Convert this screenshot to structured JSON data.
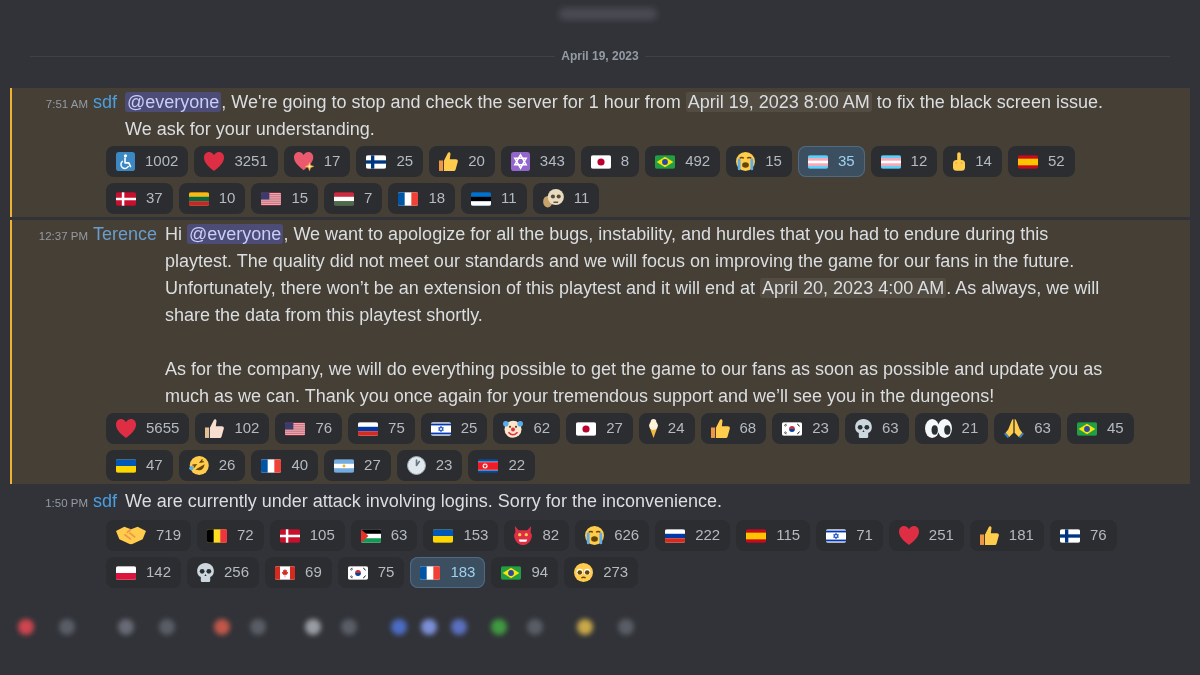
{
  "date_divider": {
    "label": "April 19, 2023"
  },
  "messages": [
    {
      "time": "7:51 AM",
      "author": {
        "name": "sdf",
        "color": "#4a9fe3"
      },
      "mentioned": true,
      "paragraphs": [
        {
          "lines": [
            [
              {
                "kind": "mention",
                "text": "@everyone"
              },
              {
                "kind": "text",
                "text": ", We're going to stop and check the server for 1 hour from "
              },
              {
                "kind": "timestamp",
                "text": "April 19, 2023 8:00 AM"
              },
              {
                "kind": "text",
                "text": " to fix the black screen issue."
              }
            ],
            [
              {
                "kind": "text",
                "text": "We ask for your understanding."
              }
            ]
          ]
        }
      ],
      "reactions": [
        {
          "kind": "wheelchair",
          "count": "1002",
          "selected": false
        },
        {
          "kind": "heart",
          "count": "3251",
          "selected": false
        },
        {
          "kind": "sparkleheart",
          "count": "17",
          "selected": false
        },
        {
          "kind": "finland",
          "count": "25",
          "selected": false
        },
        {
          "kind": "thumbsup",
          "count": "20",
          "selected": false
        },
        {
          "kind": "starofdavid",
          "count": "343",
          "selected": false
        },
        {
          "kind": "japan",
          "count": "8",
          "selected": false
        },
        {
          "kind": "brazil",
          "count": "492",
          "selected": false
        },
        {
          "kind": "crying",
          "count": "15",
          "selected": false
        },
        {
          "kind": "transgender",
          "count": "35",
          "selected": true
        },
        {
          "kind": "transgender",
          "count": "12",
          "selected": false
        },
        {
          "kind": "middlefinger",
          "count": "14",
          "selected": false
        },
        {
          "kind": "spain",
          "count": "52",
          "selected": false
        },
        {
          "kind": "denmark",
          "count": "37",
          "selected": false
        },
        {
          "kind": "lithuania",
          "count": "10",
          "selected": false
        },
        {
          "kind": "usa",
          "count": "15",
          "selected": false
        },
        {
          "kind": "hungary",
          "count": "7",
          "selected": false
        },
        {
          "kind": "france",
          "count": "18",
          "selected": false
        },
        {
          "kind": "estonia",
          "count": "11",
          "selected": false
        },
        {
          "kind": "custom",
          "count": "11",
          "selected": false
        }
      ]
    },
    {
      "time": "12:37 PM",
      "author": {
        "name": "Terence",
        "color": "#6b9dcc"
      },
      "mentioned": true,
      "paragraphs": [
        {
          "lines": [
            [
              {
                "kind": "text",
                "text": "Hi "
              },
              {
                "kind": "mention",
                "text": "@everyone"
              },
              {
                "kind": "text",
                "text": ", We want to apologize for all the bugs, instability, and hurdles that you had to endure during this playtest. The quality did not meet our standards and we will focus on improving the game for our fans in the future. Unfortunately, there won’t be an extension of this playtest and it will end at "
              },
              {
                "kind": "timestamp",
                "text": "April 20, 2023 4:00 AM"
              },
              {
                "kind": "text",
                "text": ". As always, we will share the data from this playtest shortly."
              }
            ]
          ]
        },
        {
          "lines": [
            [
              {
                "kind": "text",
                "text": "As for the company, we will do everything possible to get the game to our fans as soon as possible and update you as much as we can. Thank you once again for your tremendous support and we’ll see you in the dungeons!"
              }
            ]
          ]
        }
      ],
      "reactions": [
        {
          "kind": "heart",
          "count": "5655",
          "selected": false
        },
        {
          "kind": "thumbsuplight",
          "count": "102",
          "selected": false
        },
        {
          "kind": "usa",
          "count": "76",
          "selected": false
        },
        {
          "kind": "russia",
          "count": "75",
          "selected": false
        },
        {
          "kind": "israel",
          "count": "25",
          "selected": false
        },
        {
          "kind": "clown",
          "count": "62",
          "selected": false
        },
        {
          "kind": "japan",
          "count": "27",
          "selected": false
        },
        {
          "kind": "icecream",
          "count": "24",
          "selected": false
        },
        {
          "kind": "thumbsup",
          "count": "68",
          "selected": false
        },
        {
          "kind": "southkorea",
          "count": "23",
          "selected": false
        },
        {
          "kind": "skull",
          "count": "63",
          "selected": false
        },
        {
          "kind": "eyes",
          "count": "21",
          "selected": false
        },
        {
          "kind": "pray",
          "count": "63",
          "selected": false
        },
        {
          "kind": "brazil",
          "count": "45",
          "selected": false
        },
        {
          "kind": "ukraine",
          "count": "47",
          "selected": false
        },
        {
          "kind": "rofl",
          "count": "26",
          "selected": false
        },
        {
          "kind": "france",
          "count": "40",
          "selected": false
        },
        {
          "kind": "argentina",
          "count": "27",
          "selected": false
        },
        {
          "kind": "clock",
          "count": "23",
          "selected": false
        },
        {
          "kind": "northkorea",
          "count": "22",
          "selected": false
        }
      ]
    },
    {
      "time": "1:50 PM",
      "author": {
        "name": "sdf",
        "color": "#4a9fe3"
      },
      "mentioned": false,
      "paragraphs": [
        {
          "lines": [
            [
              {
                "kind": "text",
                "text": "We are currently under attack involving logins. Sorry for the inconvenience."
              }
            ]
          ]
        }
      ],
      "reactions": [
        {
          "kind": "handshake",
          "count": "719",
          "selected": false
        },
        {
          "kind": "belgium",
          "count": "72",
          "selected": false
        },
        {
          "kind": "denmark",
          "count": "105",
          "selected": false
        },
        {
          "kind": "palestine",
          "count": "63",
          "selected": false
        },
        {
          "kind": "ukraine",
          "count": "153",
          "selected": false
        },
        {
          "kind": "ogre",
          "count": "82",
          "selected": false
        },
        {
          "kind": "crying",
          "count": "626",
          "selected": false
        },
        {
          "kind": "russia",
          "count": "222",
          "selected": false
        },
        {
          "kind": "spain",
          "count": "115",
          "selected": false
        },
        {
          "kind": "israel",
          "count": "71",
          "selected": false
        },
        {
          "kind": "heart",
          "count": "251",
          "selected": false
        },
        {
          "kind": "thumbsup",
          "count": "181",
          "selected": false
        },
        {
          "kind": "finland",
          "count": "76",
          "selected": false
        },
        {
          "kind": "poland",
          "count": "142",
          "selected": false
        },
        {
          "kind": "skull",
          "count": "256",
          "selected": false
        },
        {
          "kind": "canada",
          "count": "69",
          "selected": false
        },
        {
          "kind": "southkorea",
          "count": "75",
          "selected": false
        },
        {
          "kind": "france",
          "count": "183",
          "selected": true
        },
        {
          "kind": "brazil",
          "count": "94",
          "selected": false
        },
        {
          "kind": "pleading",
          "count": "273",
          "selected": false
        }
      ]
    }
  ]
}
